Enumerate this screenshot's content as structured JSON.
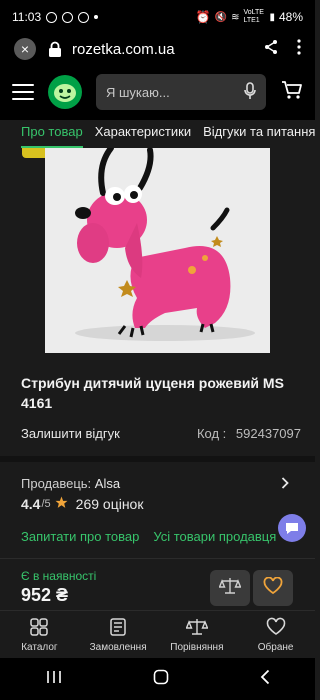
{
  "status": {
    "time": "11:03",
    "battery": "48%",
    "network": "VoLTE LTE1"
  },
  "browser": {
    "url": "rozetka.com.ua"
  },
  "header": {
    "search_placeholder": "Я шукаю..."
  },
  "tabs": [
    {
      "label": "Про товар",
      "active": true
    },
    {
      "label": "Характеристики",
      "active": false
    },
    {
      "label": "Відгуки та питання",
      "active": false
    }
  ],
  "product": {
    "title": "Стрибун дитячий цуценя рожевий MS 4161",
    "leave_review": "Залишити відгук",
    "code_label": "Код :",
    "code_value": "592437097",
    "seller_label": "Продавець:",
    "seller_name": "Alsa",
    "rating_value": "4.4",
    "rating_scale": "/5",
    "reviews_count": "269 оцінок",
    "ask_link": "Запитати про товар",
    "seller_items_link": "Усі товари продавця",
    "stock_status": "Є в наявності",
    "price": "952 ₴"
  },
  "bottom_nav": [
    {
      "label": "Каталог",
      "icon": "catalog-icon"
    },
    {
      "label": "Замовлення",
      "icon": "orders-icon"
    },
    {
      "label": "Порівняння",
      "icon": "compare-icon"
    },
    {
      "label": "Обране",
      "icon": "heart-icon"
    }
  ],
  "colors": {
    "accent_green": "#37c46b",
    "brand_green": "#00a046",
    "favorite_orange": "#f0a43a",
    "toy_pink": "#e8408a"
  }
}
